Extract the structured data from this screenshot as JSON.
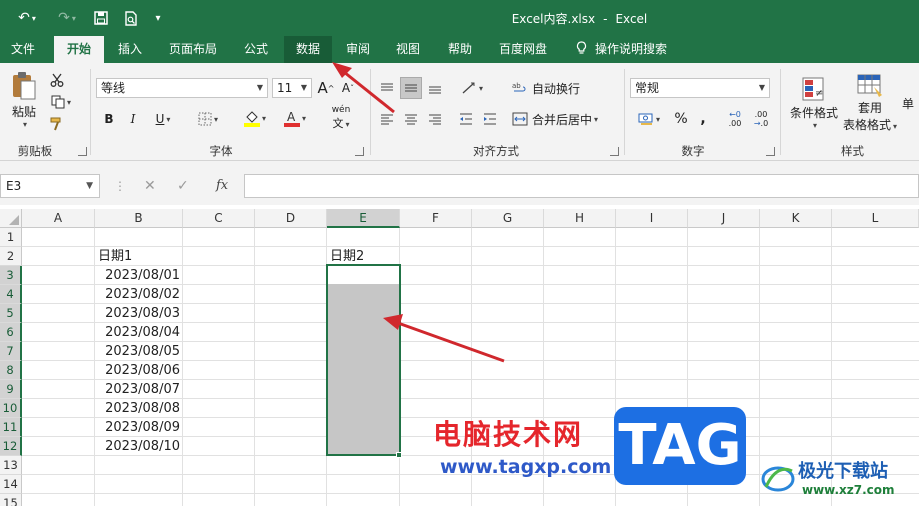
{
  "window": {
    "title": "Excel内容.xlsx",
    "separator": "-",
    "app": "Excel"
  },
  "qat": {
    "undo": "↶",
    "redo": "↷",
    "save": "🖫",
    "preview": "⎙",
    "more": "▾"
  },
  "tabs": [
    {
      "label": "文件"
    },
    {
      "label": "开始"
    },
    {
      "label": "插入"
    },
    {
      "label": "页面布局"
    },
    {
      "label": "公式"
    },
    {
      "label": "数据"
    },
    {
      "label": "审阅"
    },
    {
      "label": "视图"
    },
    {
      "label": "帮助"
    },
    {
      "label": "百度网盘"
    },
    {
      "label": "操作说明搜索"
    }
  ],
  "ribbon": {
    "clipboard": {
      "paste": "粘贴",
      "label": "剪贴板"
    },
    "font": {
      "name": "等线",
      "size": "11",
      "grow": "A",
      "shrink": "A",
      "bold": "B",
      "italic": "I",
      "underline": "U",
      "phonetic": "wén",
      "label": "字体"
    },
    "alignment": {
      "wrap": "自动换行",
      "merge": "合并后居中",
      "label": "对齐方式"
    },
    "number": {
      "format": "常规",
      "percent": "%",
      "comma": ",",
      "inc_dec": ".00",
      "dec_dec": ".0",
      "label": "数字"
    },
    "styles": {
      "conditional": "条件格式",
      "table_format_1": "套用",
      "table_format_2": "表格格式",
      "cell_style": "单",
      "label": "样式"
    }
  },
  "formula_bar": {
    "name_box": "E3",
    "cancel": "✕",
    "enter": "✓",
    "fx": "fx",
    "value": ""
  },
  "sheet": {
    "columns": [
      "A",
      "B",
      "C",
      "D",
      "E",
      "F",
      "G",
      "H",
      "I",
      "J",
      "K",
      "L"
    ],
    "rows": [
      "1",
      "2",
      "3",
      "4",
      "5",
      "6",
      "7",
      "8",
      "9",
      "10",
      "11",
      "12",
      "13",
      "14",
      "15"
    ],
    "header_b": "日期1",
    "header_e": "日期2",
    "dates": [
      "2023/08/01",
      "2023/08/02",
      "2023/08/03",
      "2023/08/04",
      "2023/08/05",
      "2023/08/06",
      "2023/08/07",
      "2023/08/08",
      "2023/08/09",
      "2023/08/10"
    ]
  },
  "watermark": {
    "cn": "电脑技术网",
    "url": "www.tagxp.com",
    "tag": "TAG",
    "site": "极光下载站",
    "site_url": "www.xz7.com"
  },
  "colors": {
    "excel_green": "#217346",
    "selection_fill": "#c6c6c6",
    "arrow": "#d0282d"
  }
}
